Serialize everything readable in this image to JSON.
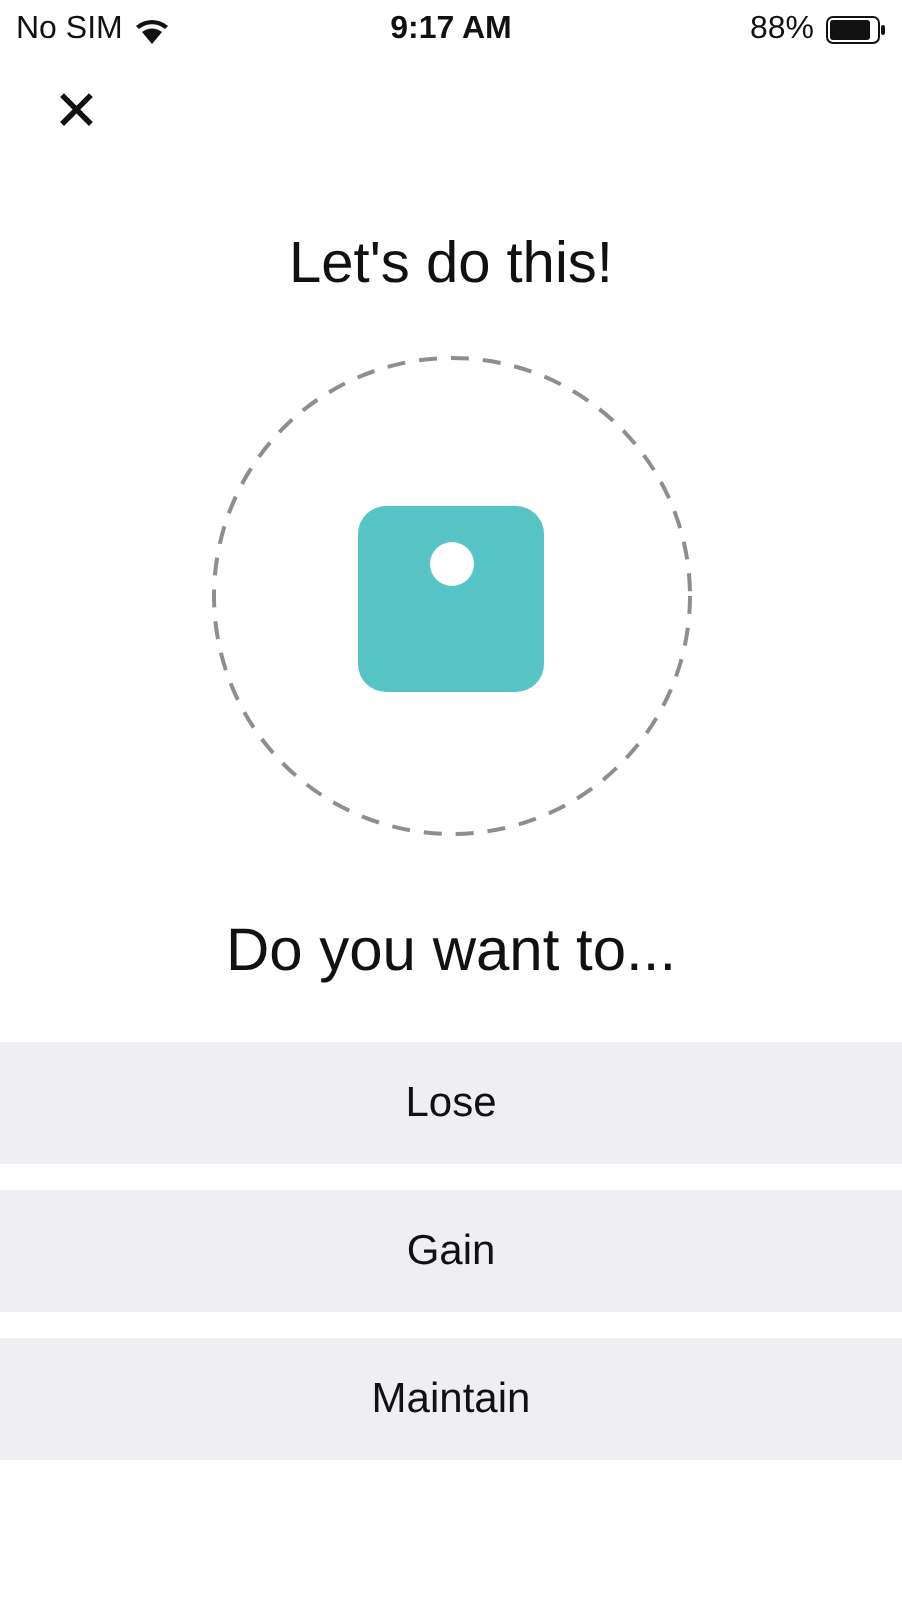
{
  "status_bar": {
    "carrier": "No SIM",
    "time": "9:17 AM",
    "battery": "88%"
  },
  "close_label": "✕",
  "title": "Let's do this!",
  "question": "Do you want to...",
  "options": [
    {
      "label": "Lose"
    },
    {
      "label": "Gain"
    },
    {
      "label": "Maintain"
    }
  ]
}
